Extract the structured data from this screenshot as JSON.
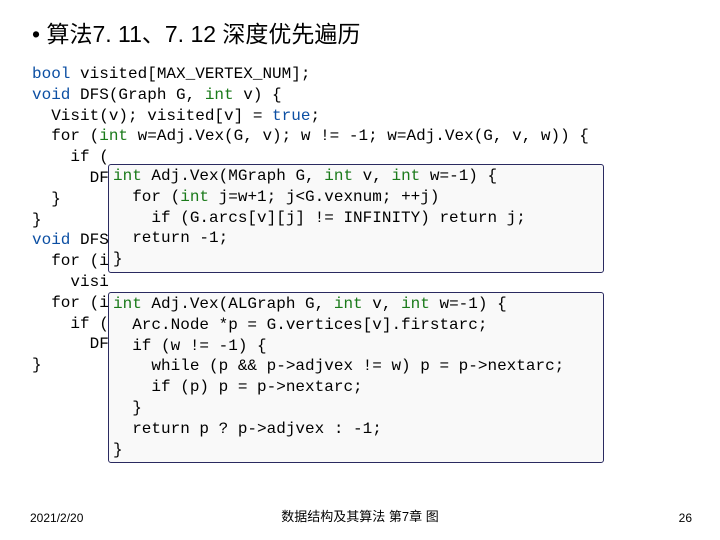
{
  "title": "• 算法7. 11、7. 12 深度优先遍历",
  "main_code": {
    "l1a": "bool",
    "l1b": " visited[MAX_VERTEX_NUM];",
    "l2a": "void",
    "l2b": " DFS(Graph G, ",
    "l2c": "int",
    "l2d": " v) {",
    "l3a": "  Visit(v); visited[v] = ",
    "l3b": "true",
    "l3c": ";",
    "l4a": "  for (",
    "l4b": "int",
    "l4c": " w=Adj.Vex(G, v); w != -1; w=Adj.Vex(G, v, w)) {",
    "l5": "    if (",
    "l6": "      DF",
    "l7": "  }",
    "l8": "}",
    "l9a": "void",
    "l9b": " DFS",
    "l10a": "  for (i",
    "l11": "    visi",
    "l12a": "  for (i",
    "l13": "    if (",
    "l14": "      DF",
    "l15": "}"
  },
  "box1": {
    "l1a": "int",
    "l1b": " Adj.Vex(MGraph G, ",
    "l1c": "int",
    "l1d": " v, ",
    "l1e": "int",
    "l1f": " w=-1) {",
    "l2a": "  for (",
    "l2b": "int",
    "l2c": " j=w+1; j<G.vexnum; ++j)",
    "l3": "    if (G.arcs[v][j] != INFINITY) return j;",
    "l4": "  return -1;",
    "l5": "}"
  },
  "box2": {
    "l1a": "int",
    "l1b": " Adj.Vex(ALGraph G, ",
    "l1c": "int",
    "l1d": " v, ",
    "l1e": "int",
    "l1f": " w=-1) {",
    "l2": "  Arc.Node *p = G.vertices[v].firstarc;",
    "l3": "  if (w != -1) {",
    "l4": "    while (p && p->adjvex != w) p = p->nextarc;",
    "l5": "    if (p) p = p->nextarc;",
    "l6": "  }",
    "l7": "  return p ? p->adjvex : -1;",
    "l8": "}"
  },
  "footer": {
    "date": "2021/2/20",
    "center": "数据结构及其算法 第7章 图",
    "page": "26"
  }
}
